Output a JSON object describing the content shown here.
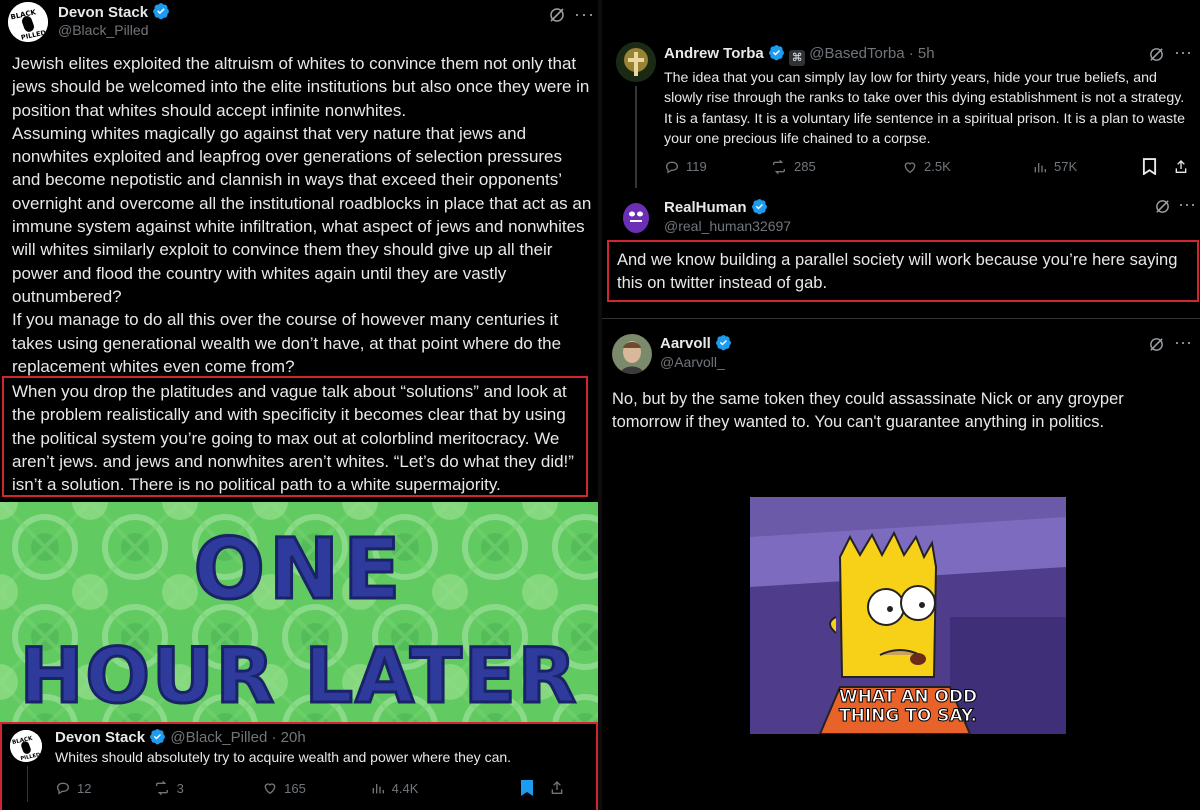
{
  "left": {
    "main_post": {
      "author_name": "Devon Stack",
      "author_handle": "@Black_Pilled",
      "avatar_text": [
        "BLACK",
        "PILLED"
      ],
      "paragraphs": [
        "Jewish elites exploited the altruism of whites to convince them not only that jews should be welcomed into the elite institutions but also once they were in position that whites should accept infinite nonwhites.",
        "Assuming whites magically go against that very nature that jews and nonwhites exploited and leapfrog over generations of selection pressures and become nepotistic and clannish in ways that exceed their opponents’ overnight and overcome all the institutional roadblocks in place that act as an immune system against white infiltration, what aspect of jews and nonwhites will whites similarly exploit to convince them they should give up all their power and flood the country with whites again until they are vastly outnumbered?",
        "If you manage to do all this over the course of however many centuries it takes using generational wealth we don’t have, at that point where do the replacement whites even come from?"
      ],
      "highlighted_paragraph": "When you drop the platitudes and vague talk about “solutions” and look at the problem realistically and with specificity it becomes clear that by using the political system you’re going to max out at colorblind meritocracy. We aren’t jews. and jews and nonwhites aren’t whites. “Let’s do what they did!” isn’t a solution. There is no political path to a white supermajority."
    },
    "meme_card": {
      "line1": "ONE",
      "line2": "HOUR LATER"
    },
    "reply_post": {
      "author_name": "Devon Stack",
      "author_handle": "@Black_Pilled",
      "time": "20h",
      "text": "Whites should absolutely try to acquire wealth and power where they can.",
      "stats": {
        "replies": "12",
        "reposts": "3",
        "likes": "165",
        "views": "4.4K"
      }
    }
  },
  "right": {
    "torba_post": {
      "author_name": "Andrew Torba",
      "author_handle": "@BasedTorba",
      "time": "5h",
      "text": "The idea that you can simply lay low for thirty years, hide your true beliefs, and slowly rise through the ranks to take over this dying establishment is not a strategy. It is a fantasy. It is a voluntary life sentence in a spiritual prison. It is a plan to waste your one precious life chained to a corpse.",
      "stats": {
        "replies": "119",
        "reposts": "285",
        "likes": "2.5K",
        "views": "57K"
      }
    },
    "realhuman_post": {
      "author_name": "RealHuman",
      "author_handle": "@real_human32697",
      "text": "And we know building a parallel society will work because you’re here saying this on twitter instead of gab."
    },
    "aarvoll_post": {
      "author_name": "Aarvoll",
      "author_handle": "@Aarvoll_",
      "text": "No, but by the same token they could assassinate Nick or any groyper tomorrow if they wanted to. You can't guarantee anything in politics.",
      "gif_caption_line1": "WHAT AN ODD",
      "gif_caption_line2": "THING TO SAY."
    }
  },
  "colors": {
    "verified_blue": "#1d9bf0",
    "highlight_red": "#d0262f",
    "muted_gray": "#71767b",
    "bookmark_blue": "#1d9bf0"
  }
}
